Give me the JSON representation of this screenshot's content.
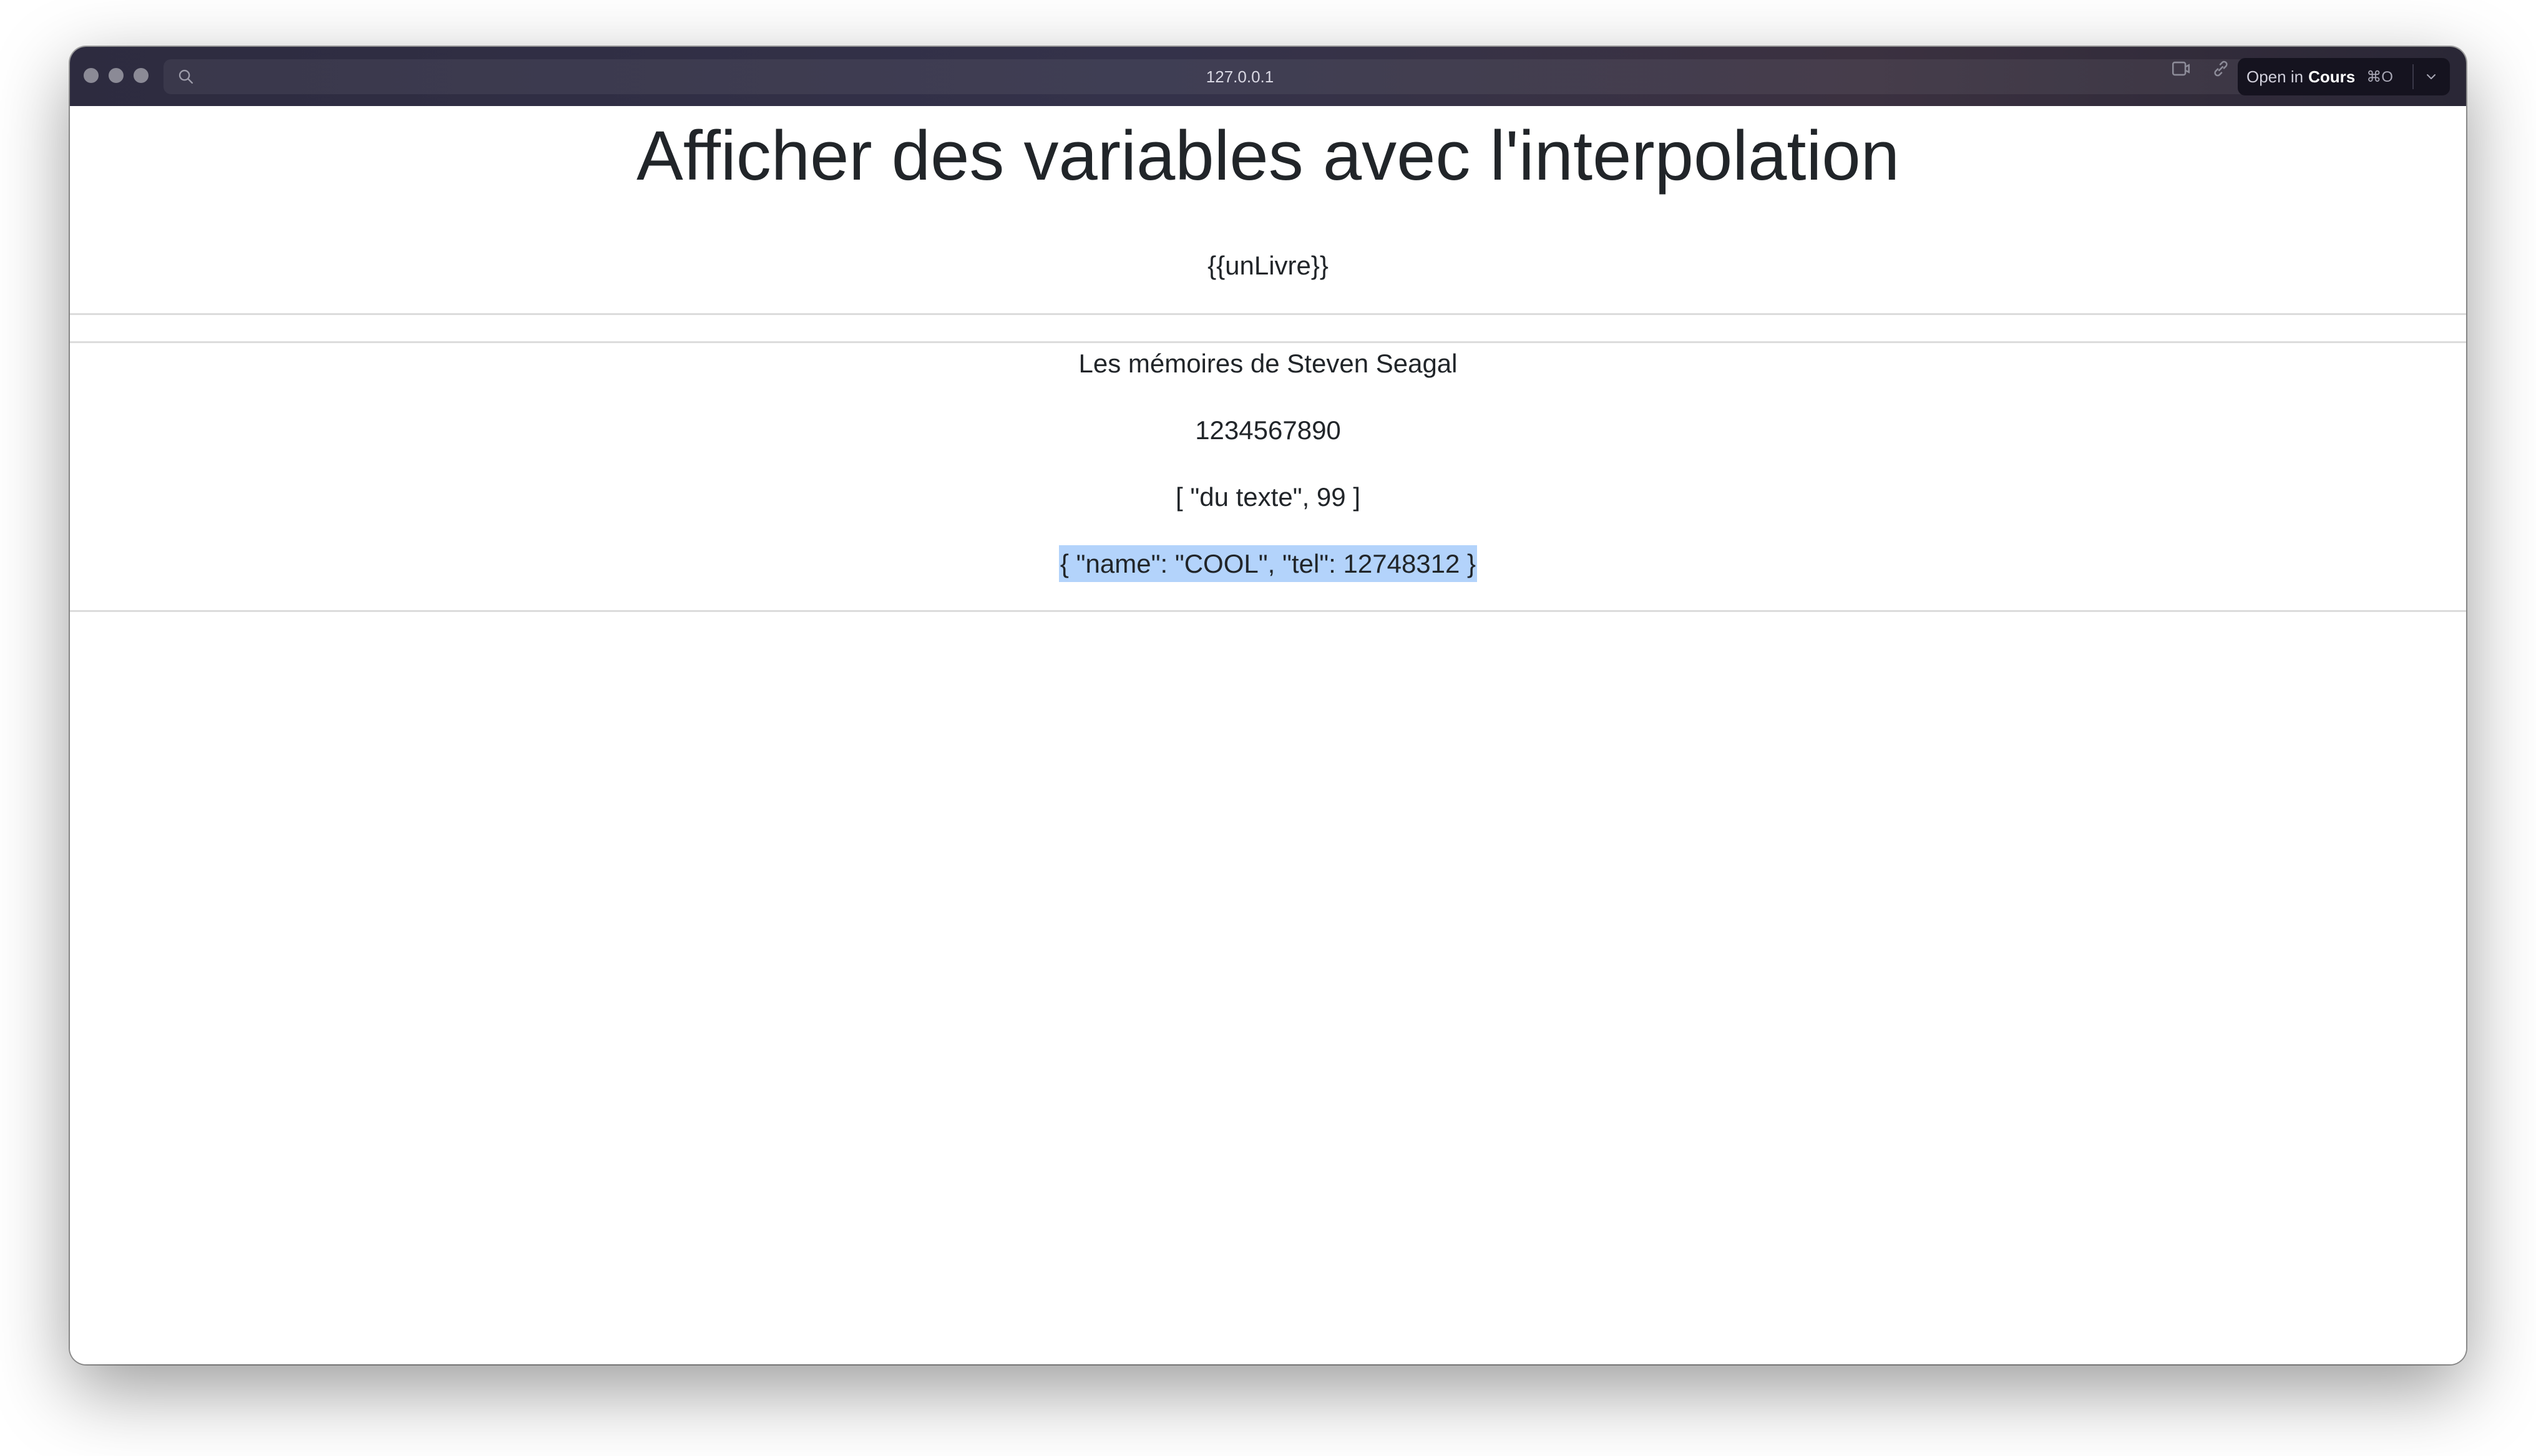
{
  "browser": {
    "url": "127.0.0.1",
    "open_in_prefix": "Open in",
    "open_in_app": "Cours",
    "open_in_shortcut": "⌘O"
  },
  "page": {
    "title": "Afficher des variables avec l'interpolation",
    "raw_interpolation": "{{unLivre}}",
    "values": [
      "Les mémoires de Steven Seagal",
      "1234567890",
      "[ \"du texte\", 99 ]",
      "{ \"name\": \"COOL\", \"tel\": 12748312 }"
    ]
  },
  "colors": {
    "selection_highlight": "#b3d3fb",
    "text": "#212529"
  }
}
